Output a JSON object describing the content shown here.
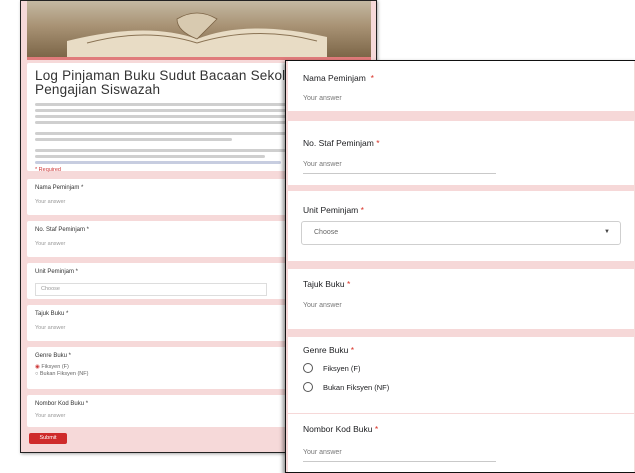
{
  "back_form": {
    "title": "Log Pinjaman Buku Sudut Bacaan Sekolah Pengajian Siswazah",
    "required_note": "* Required",
    "submit_label": "Submit",
    "questions": [
      {
        "label": "Nama Peminjam *",
        "answer": "Your answer"
      },
      {
        "label": "No. Staf Peminjam *",
        "answer": "Your answer"
      },
      {
        "label": "Unit Peminjam *",
        "answer": "Choose"
      },
      {
        "label": "Tajuk Buku *",
        "answer": "Your answer"
      },
      {
        "label": "Genre Buku *",
        "options": [
          "Fiksyen (F)",
          "Bukan Fiksyen (NF)"
        ]
      },
      {
        "label": "Nombor Kod Buku *",
        "answer": "Your answer"
      }
    ]
  },
  "front_form": {
    "nama": {
      "label": "Nama Peminjam",
      "required": "*",
      "answer": "Your answer"
    },
    "staf": {
      "label": "No. Staf Peminjam",
      "required": "*",
      "answer": "Your answer"
    },
    "unit": {
      "label": "Unit Peminjam",
      "required": "*",
      "placeholder": "Choose"
    },
    "tajuk": {
      "label": "Tajuk Buku",
      "required": "*",
      "answer": "Your answer"
    },
    "genre": {
      "label": "Genre Buku",
      "required": "*",
      "options": [
        "Fiksyen (F)",
        "Bukan Fiksyen (NF)"
      ]
    },
    "kod": {
      "label": "Nombor Kod Buku",
      "required": "*",
      "answer": "Your answer"
    }
  },
  "colors": {
    "accent": "#d93025",
    "page_bg": "#f6d8d8",
    "submit": "#cf2b2b"
  }
}
